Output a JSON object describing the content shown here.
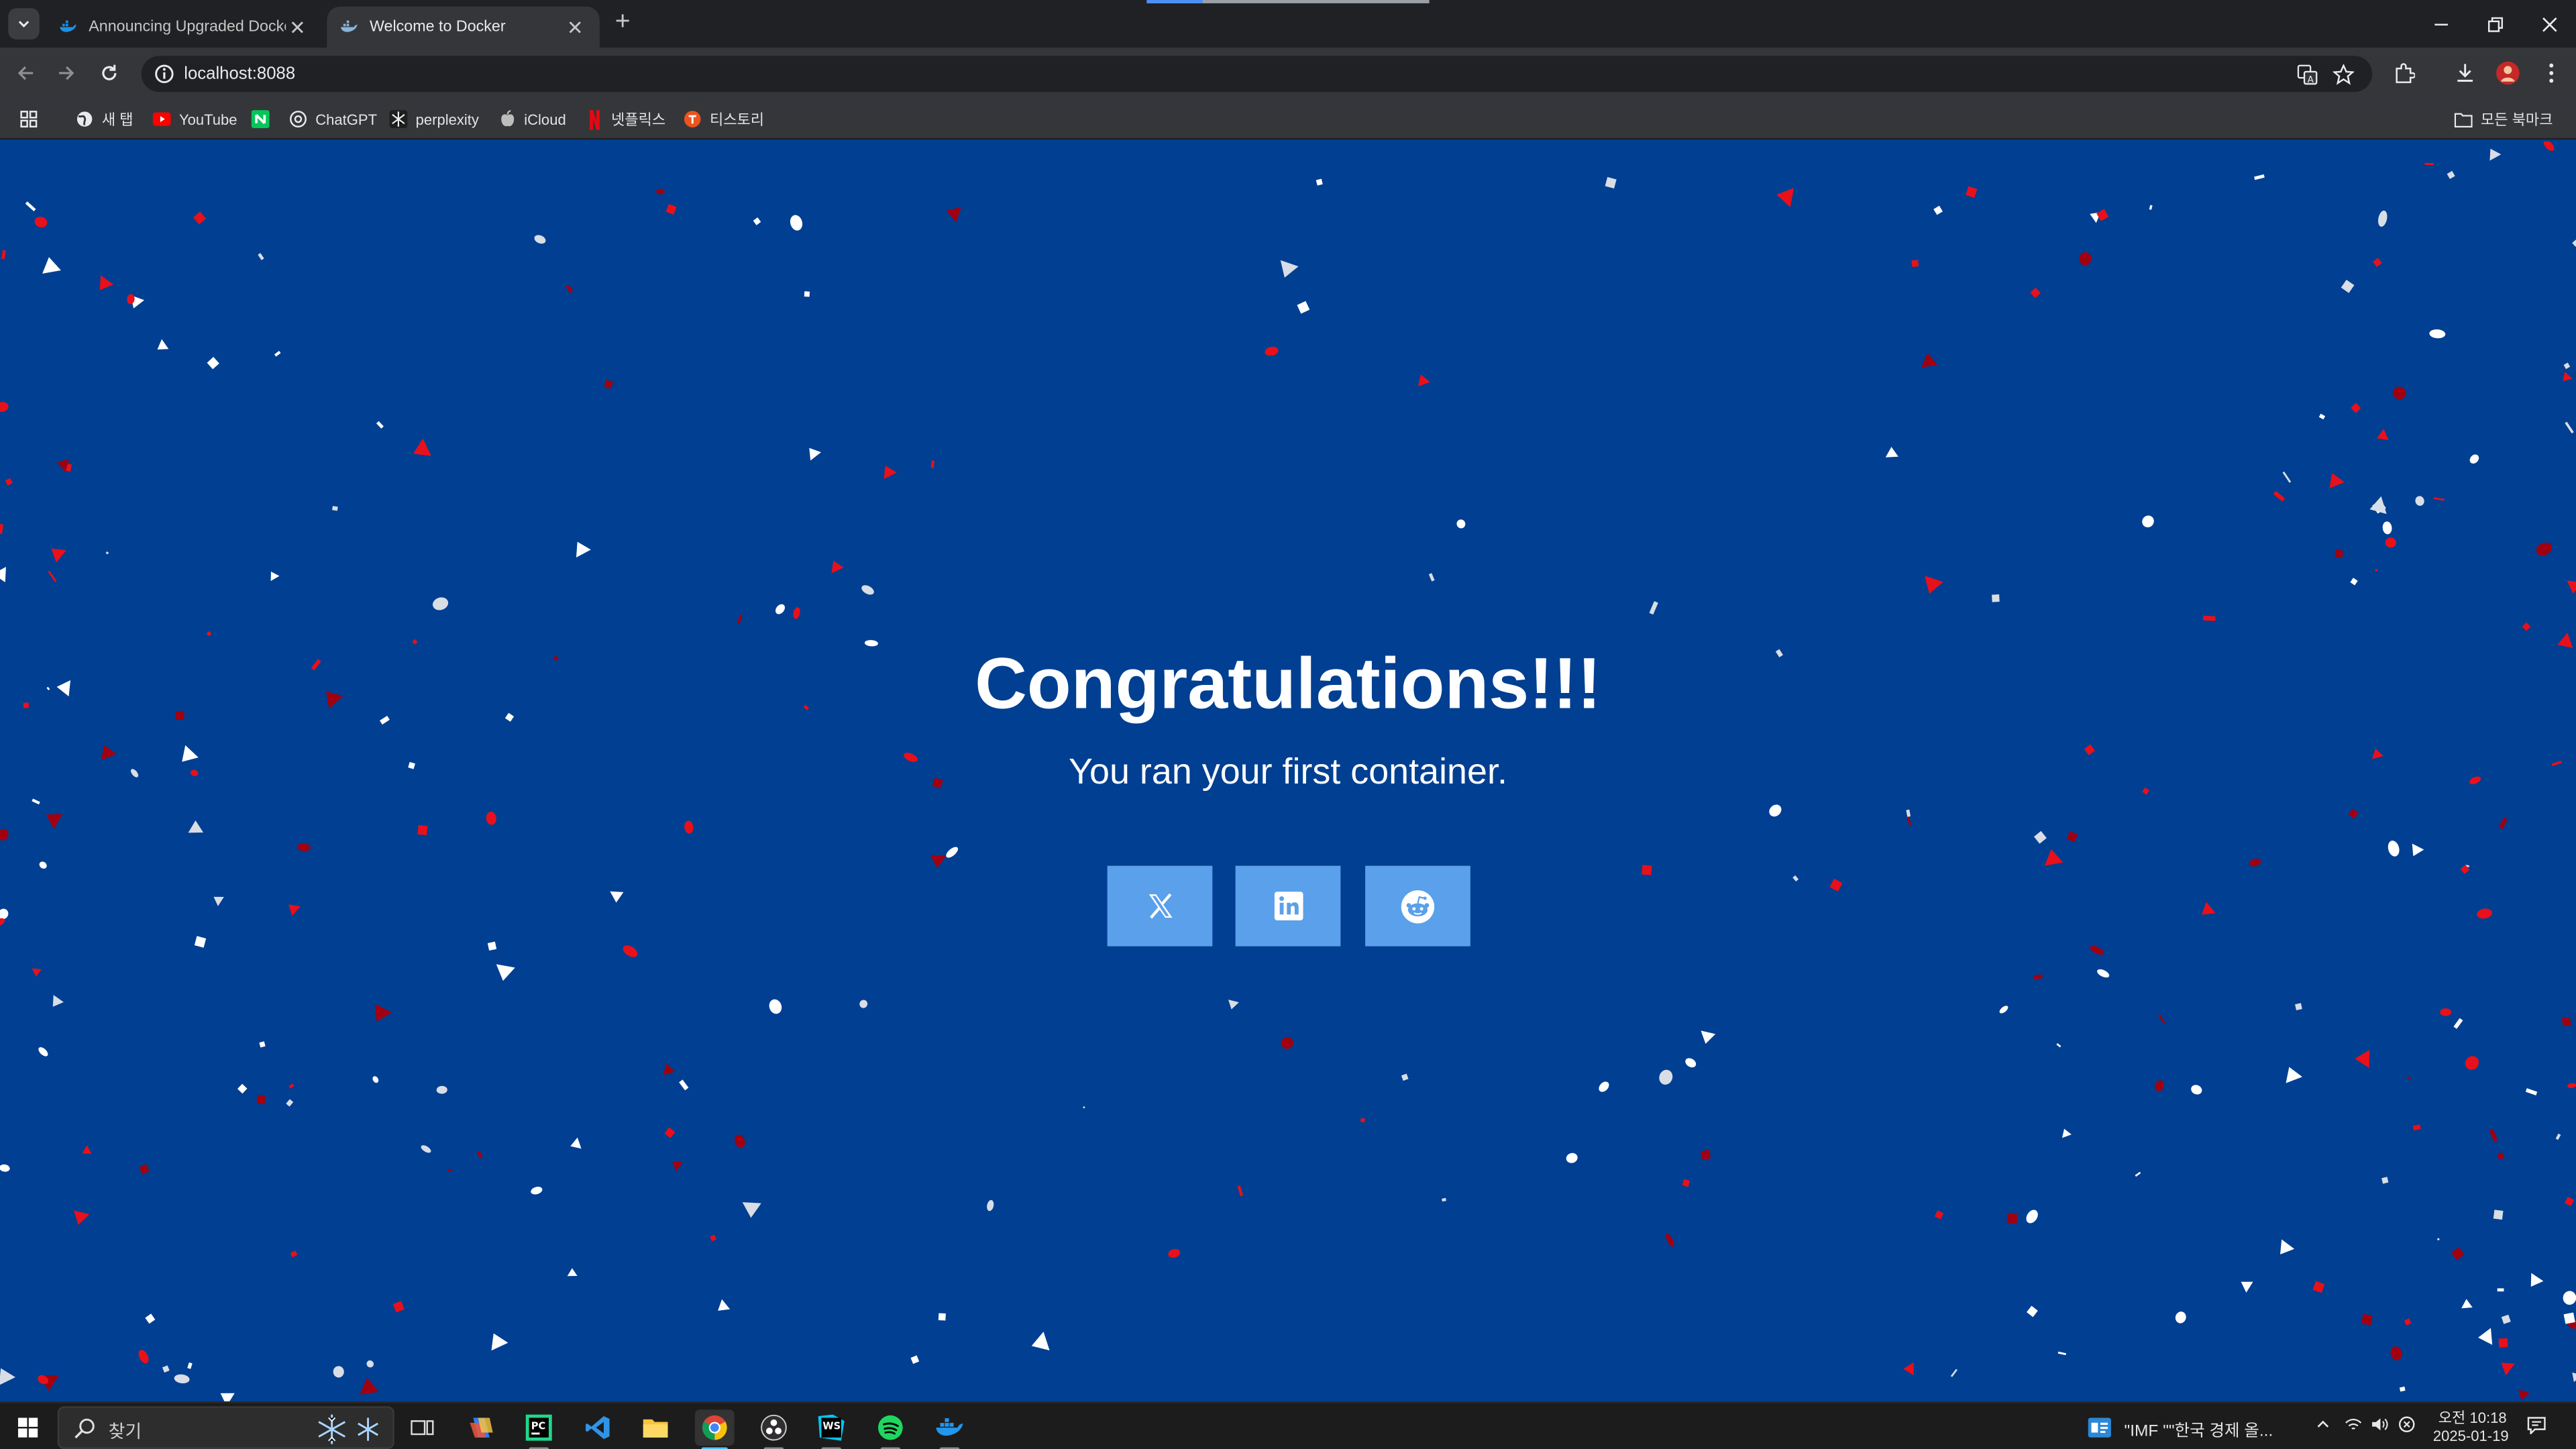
{
  "browser": {
    "tabs": [
      {
        "title": "Announcing Upgraded Docker",
        "active": false
      },
      {
        "title": "Welcome to Docker",
        "active": true
      }
    ],
    "url": "localhost:8088",
    "bookmarks": [
      {
        "label": "새 탭",
        "icon": "globe-icon"
      },
      {
        "label": "YouTube",
        "icon": "youtube-icon"
      },
      {
        "label": "",
        "icon": "naver-icon"
      },
      {
        "label": "ChatGPT",
        "icon": "chatgpt-icon"
      },
      {
        "label": "perplexity",
        "icon": "perplexity-icon"
      },
      {
        "label": "iCloud",
        "icon": "apple-icon"
      },
      {
        "label": "넷플릭스",
        "icon": "netflix-icon"
      },
      {
        "label": "티스토리",
        "icon": "tistory-icon"
      }
    ],
    "all_bookmarks_label": "모든 북마크"
  },
  "page": {
    "headline": "Congratulations!!!",
    "subline": "You ran your first container.",
    "share_buttons": [
      {
        "icon": "x-twitter-icon"
      },
      {
        "icon": "linkedin-icon"
      },
      {
        "icon": "reddit-icon"
      }
    ],
    "colors": {
      "background": "#003f91",
      "button": "#5aa0ea",
      "confetti_red": "#e8101b",
      "confetti_dark_red": "#a00010",
      "confetti_white": "#ffffff"
    }
  },
  "taskbar": {
    "search_placeholder": "찾기",
    "apps": [
      "task-view-icon",
      "copilot-icon",
      "pycharm-icon",
      "vscode-icon",
      "file-explorer-icon",
      "chrome-icon",
      "obs-icon",
      "webstorm-icon",
      "spotify-icon",
      "docker-icon"
    ],
    "news_text": "\"IMF \"\"한국 경제 올...",
    "time": "오전 10:18",
    "date": "2025-01-19"
  }
}
